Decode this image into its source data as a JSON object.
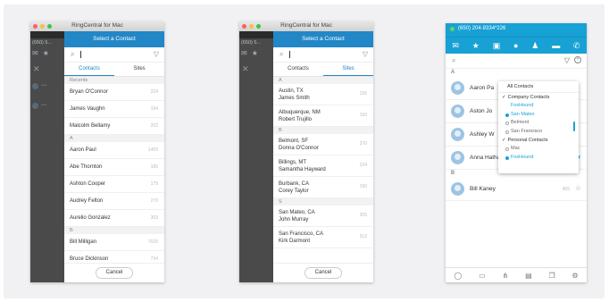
{
  "window_title": "RingCentral for Mac",
  "phone_short": "(650) 5...",
  "dialog_title": "Select a Contact",
  "tab_contacts": "Contacts",
  "tab_sites": "Sites",
  "cancel_label": "Cancel",
  "panel1": {
    "recents_header": "Recents",
    "recents": [
      {
        "name": "Bryan O'Connor",
        "ext": "224"
      },
      {
        "name": "James Vaughn",
        "ext": "194"
      },
      {
        "name": "Malcolm Bellamy",
        "ext": "202"
      }
    ],
    "section_a": "A",
    "a_contacts": [
      {
        "name": "Aaron Paul",
        "ext": "1455"
      },
      {
        "name": "Abe Thornton",
        "ext": "185"
      },
      {
        "name": "Ashton Cooper",
        "ext": "179"
      },
      {
        "name": "Audrey Felton",
        "ext": "270"
      },
      {
        "name": "Aurelio Gonzalez",
        "ext": "303"
      }
    ],
    "section_b": "B",
    "b_contacts": [
      {
        "name": "Bill Milligan",
        "ext": "7020"
      },
      {
        "name": "Bruce Dickinson",
        "ext": "734"
      }
    ]
  },
  "panel2": {
    "section_a": "A",
    "a_sites": [
      {
        "site": "Austin, TX",
        "person": "James Smith",
        "ext": "155"
      },
      {
        "site": "Albuquerque, NM",
        "person": "Robert Trujillo",
        "ext": "150"
      }
    ],
    "section_b": "B",
    "b_sites": [
      {
        "site": "Belmont, SF",
        "person": "Donna O'Connor",
        "ext": "270"
      },
      {
        "site": "Billings, MT",
        "person": "Samantha Hayward",
        "ext": "224"
      },
      {
        "site": "Burbank, CA",
        "person": "Corey Taylor",
        "ext": "150"
      }
    ],
    "section_s": "S",
    "s_sites": [
      {
        "site": "San Mateo, CA",
        "person": "John Murray",
        "ext": "305"
      },
      {
        "site": "San Francisco, CA",
        "person": "Kirk Darmont",
        "ext": "312"
      }
    ]
  },
  "panel3": {
    "phone": "(650) 204-9334*226",
    "section_a": "A",
    "a_contacts": [
      {
        "name": "Aaron Pa",
        "ext": "",
        "starred": false
      },
      {
        "name": "Aston Jo",
        "ext": "",
        "starred": false
      },
      {
        "name": "Ashley W",
        "ext": "",
        "starred": false
      },
      {
        "name": "Anna Hathaway",
        "ext": "456",
        "starred": true
      }
    ],
    "section_b": "B",
    "b_contacts": [
      {
        "name": "Bill Kaney",
        "ext": "455",
        "starred": false
      }
    ],
    "dropdown": {
      "all": "All Contacts",
      "company": "Company Contacts",
      "company_link": "FoxHound",
      "company_items": [
        "San Mateo",
        "Belmont",
        "San Francisco"
      ],
      "company_selected": "San Mateo",
      "personal": "Personal Contacts",
      "personal_items": [
        "Mac",
        "FoxHound"
      ],
      "personal_selected": "FoxHound"
    }
  },
  "colors": {
    "header_blue": "#2187c6",
    "nav_blue": "#17a1d4",
    "presence_green": "#6bd05b"
  }
}
